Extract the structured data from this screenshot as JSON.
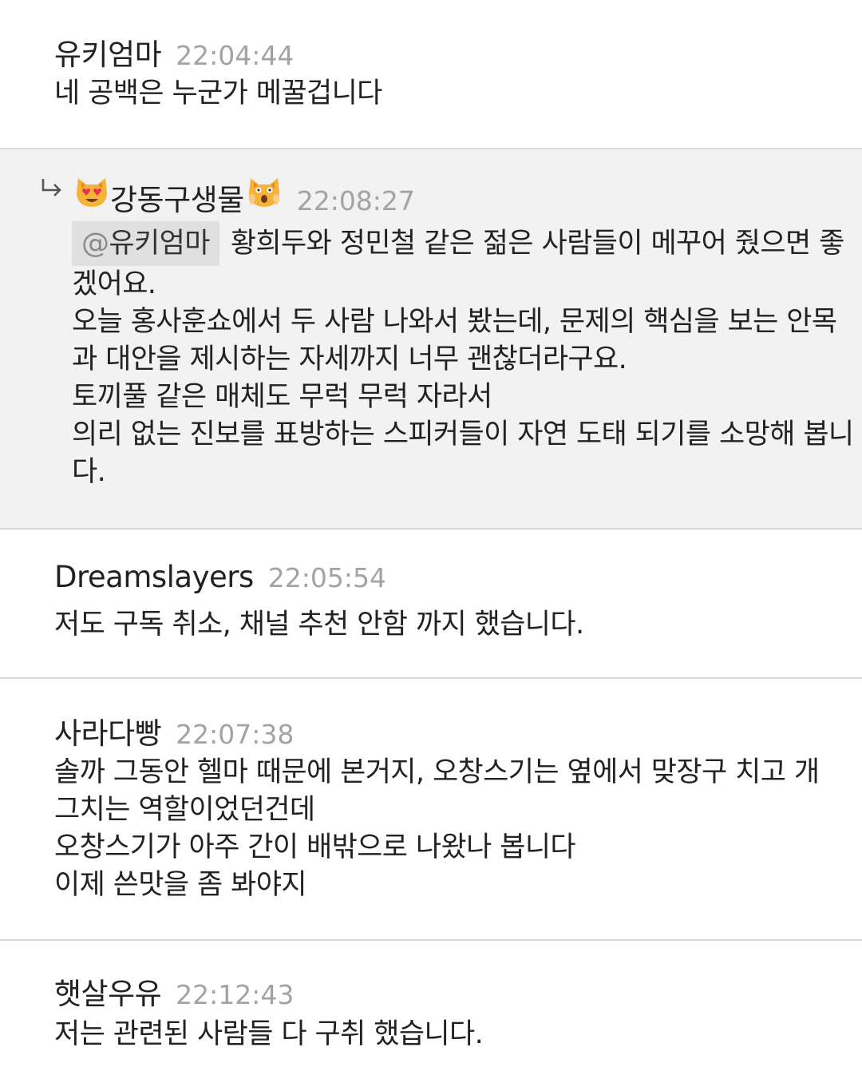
{
  "comments": [
    {
      "author": "유키엄마",
      "time": "22:04:44",
      "lines": [
        "네 공백은 누군가 메꿀겁니다"
      ]
    },
    {
      "author": "강동구생물",
      "time": "22:08:27",
      "mention_at": "@",
      "mention_name": "유키엄마",
      "lines": [
        "황희두와 정민철 같은 젊은 사람들이 메꾸어 줬으면 좋",
        "겠어요.",
        "오늘 홍사훈쇼에서 두 사람 나와서 봤는데, 문제의 핵심을 보는 안목",
        "과 대안을 제시하는 자세까지 너무 괜찮더라구요.",
        "토끼풀 같은 매체도 무럭 무럭 자라서",
        "의리 없는 진보를 표방하는 스피커들이 자연 도태 되기를 소망해 봅니",
        "다."
      ],
      "emoji_left": "smiling-cat-heart-eyes-icon",
      "emoji_right": "weary-cat-icon"
    },
    {
      "author": "Dreamslayers",
      "time": "22:05:54",
      "lines": [
        "저도 구독 취소, 채널 추천 안함 까지 했습니다."
      ]
    },
    {
      "author": "사라다빵",
      "time": "22:07:38",
      "lines": [
        "솔까 그동안 헬마 때문에 본거지, 오창스기는 옆에서 맞장구 치고 개",
        "그치는 역할이었던건데",
        "오창스기가 아주 간이 배밖으로 나왔나 봅니다",
        "이제 쓴맛을 좀 봐야지"
      ]
    },
    {
      "author": "햇살우유",
      "time": "22:12:43",
      "lines": [
        "저는 관련된 사람들 다 구취 했습니다."
      ]
    }
  ],
  "colors": {
    "reply_background": "#f2f2f2",
    "timestamp": "#a3a3a3",
    "divider": "#d8d8d8",
    "mention_background": "#e0e0e0"
  }
}
